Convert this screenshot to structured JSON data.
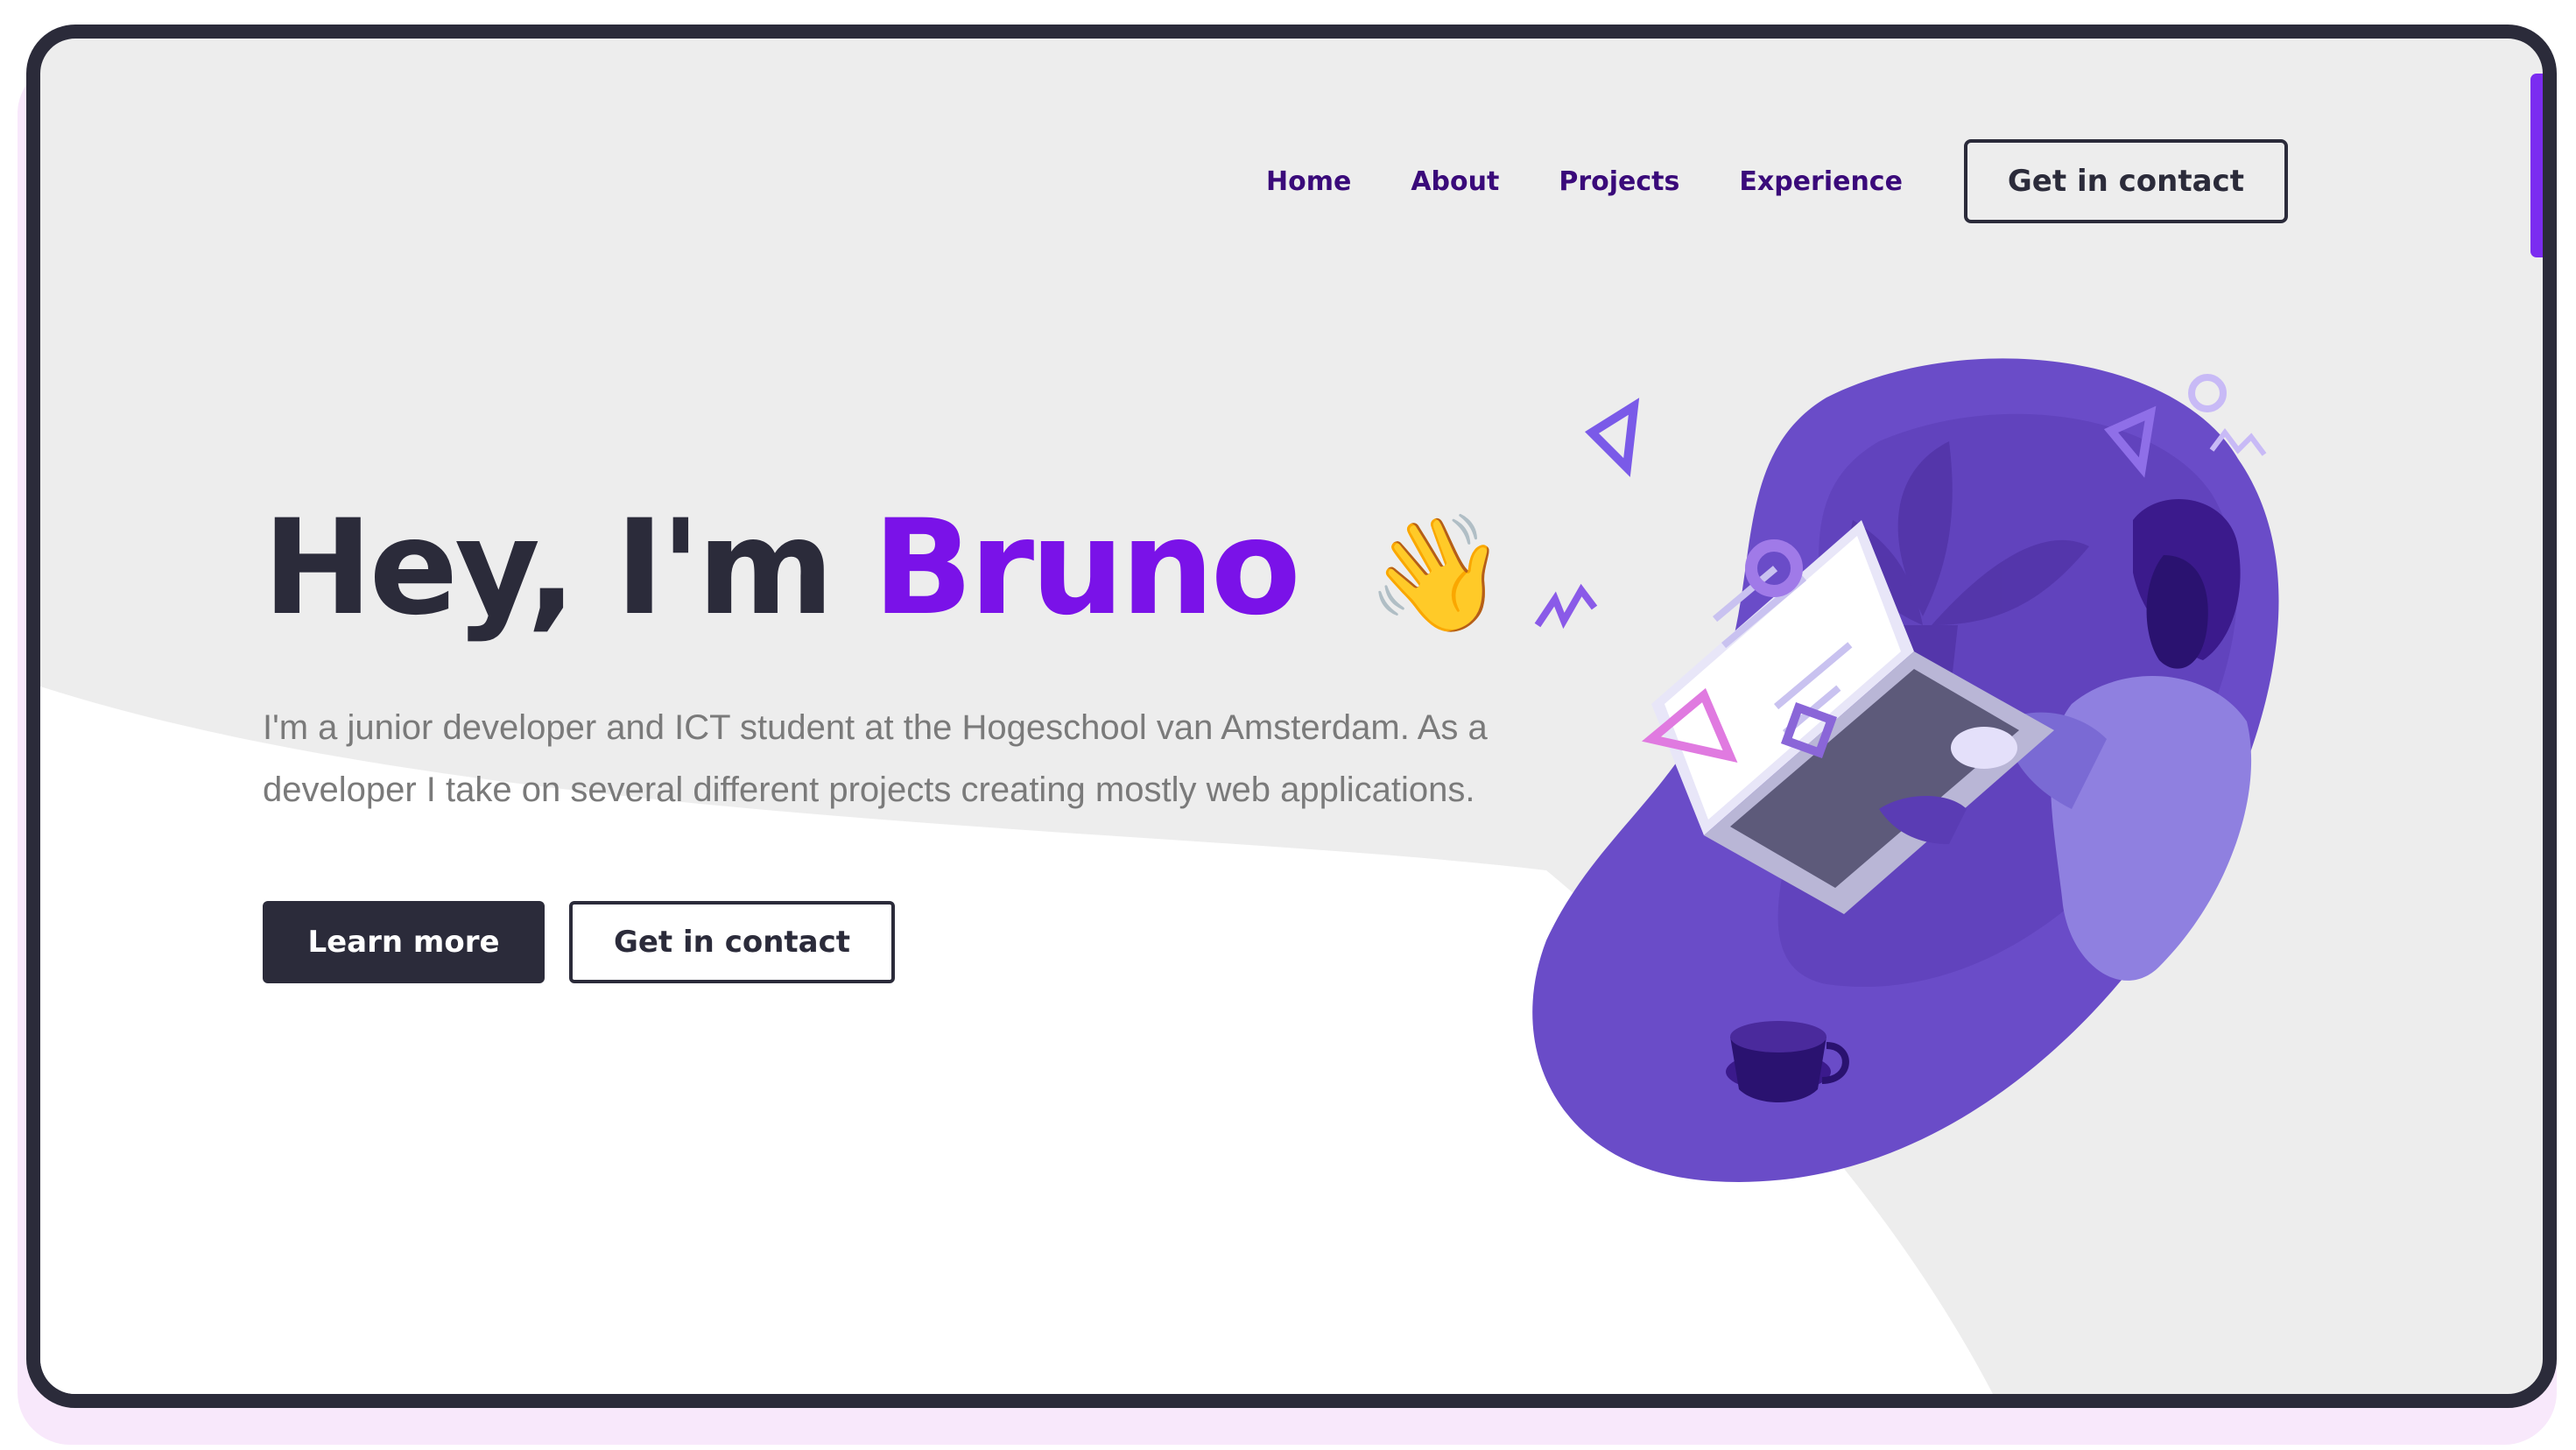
{
  "nav": {
    "links": [
      {
        "label": "Home"
      },
      {
        "label": "About"
      },
      {
        "label": "Projects"
      },
      {
        "label": "Experience"
      }
    ],
    "cta_label": "Get in contact"
  },
  "hero": {
    "greeting": "Hey, I'm",
    "name": "Bruno",
    "wave_emoji": "👋",
    "description": "I'm a junior developer and ICT student at the Hogeschool van Amsterdam. As a developer I take on several different projects creating mostly web applications.",
    "primary_button": "Learn more",
    "secondary_button": "Get in contact"
  },
  "colors": {
    "accent": "#7a12e8",
    "dark": "#2b2b3a",
    "nav_text": "#3a0a7a",
    "background": "#ededed",
    "illustration": "#6a4cc8"
  },
  "icons": [
    "waving-hand-icon",
    "developer-illustration"
  ]
}
